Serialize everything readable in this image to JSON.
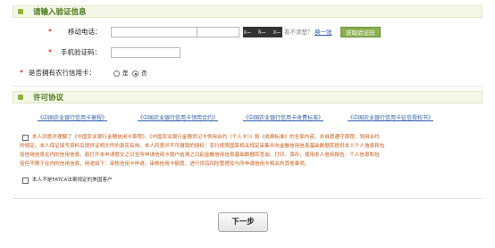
{
  "verify_section": {
    "title": "请输入验证信息"
  },
  "mobile": {
    "label": "移动电话：",
    "required_mark": "*"
  },
  "captcha": {
    "text": "x̶ k̶ x̶",
    "unclear_text": "看不清楚？",
    "refresh_link": "换一张",
    "get_code_button": "获取验证码"
  },
  "sms_code": {
    "label": "手机验证码：",
    "required_mark": "*"
  },
  "has_card": {
    "label": "是否拥有农行信用卡：",
    "required_mark": "*",
    "options": [
      "是",
      "否"
    ],
    "selected": "否"
  },
  "license_section": {
    "title": "许可协议"
  },
  "agreements": [
    "《中国农业银行信用卡章程》",
    "《中国农业银行信用卡领用合约》",
    "《中国农业银行信用卡收费标准》",
    "《中国农业银行信用卡征信授权书》"
  ],
  "agree1": {
    "line1": "本人同意并理解了《中国农业银行金穗信用卡章程》、《中国农业银行金穗贷记卡领用合约（个人卡）》和《收费标准》的全部内容，并自愿遵守章程、领用合约",
    "line2": "的规定。本人保证填写资料及提供证明文件的真实有效。本人同意并不可撤销的授权：农行按照国家相关规定采集并向金融信用信息基础数据库提供本人个人信息和包",
    "line3": "括信用信息在内的信用信息。若打开本申请提交之日至所申请信用卡销户结清之日起金融信用信息基础数据库查询、打印、保存、使用本人信用报告、个人信息和包",
    "line4": "括但不限于在内的信用信息，用途如下：审核信用卡申请、审核信用卡额度、进行贷后风险管理及与所申请信用卡相关的其他事项。"
  },
  "agree2": {
    "text": "本人不是FATCA法案规定的美国客户"
  },
  "next_button": "下一步",
  "colors": {
    "section_title": "#4a7a16",
    "accent_green": "#8ab050",
    "warning_text": "#c85a14",
    "required": "#d40000",
    "link": "#3060a8"
  }
}
